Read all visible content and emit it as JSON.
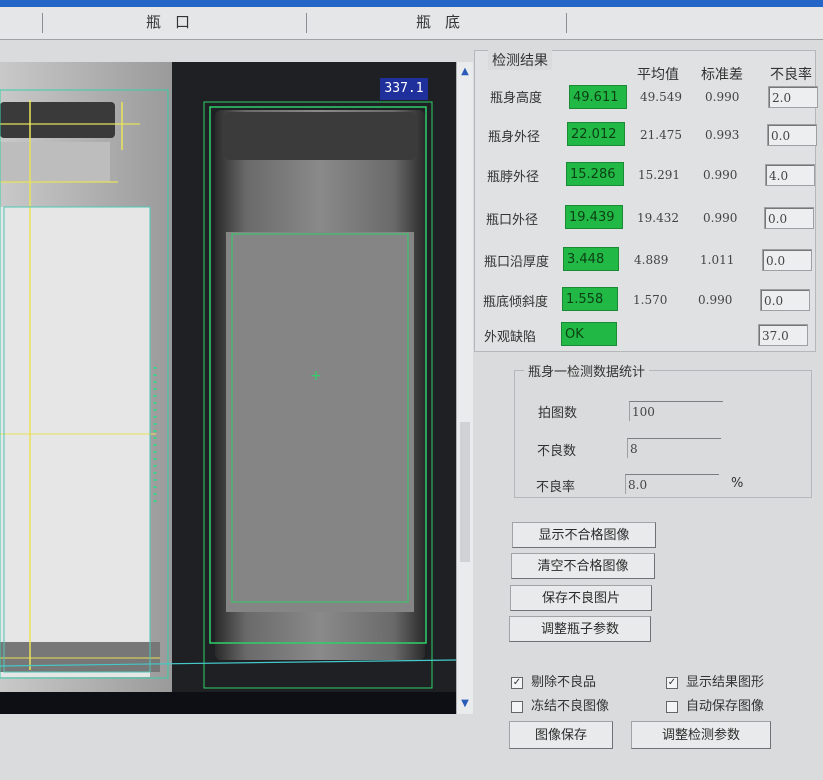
{
  "tabs": [
    {
      "label": "瓶口"
    },
    {
      "label": "瓶底"
    }
  ],
  "viewer": {
    "badge_value": "337.1"
  },
  "results": {
    "title": "检测结果",
    "columns": {
      "avg": "平均值",
      "std": "标准差",
      "rate": "不良率"
    },
    "rows": [
      {
        "label": "瓶身高度",
        "value": "49.611",
        "avg": "49.549",
        "std": "0.990",
        "rate": "2.0"
      },
      {
        "label": "瓶身外径",
        "value": "22.012",
        "avg": "21.475",
        "std": "0.993",
        "rate": "0.0"
      },
      {
        "label": "瓶脖外径",
        "value": "15.286",
        "avg": "15.291",
        "std": "0.990",
        "rate": "4.0"
      },
      {
        "label": "瓶口外径",
        "value": "19.439",
        "avg": "19.432",
        "std": "0.990",
        "rate": "0.0"
      },
      {
        "label": "瓶口沿厚度",
        "value": "3.448",
        "avg": "4.889",
        "std": "1.011",
        "rate": "0.0"
      },
      {
        "label": "瓶底倾斜度",
        "value": "1.558",
        "avg": "1.570",
        "std": "0.990",
        "rate": "0.0"
      },
      {
        "label": "外观缺陷",
        "value": "OK",
        "avg": "",
        "std": "",
        "rate": "37.0"
      }
    ]
  },
  "stats": {
    "title": "瓶身一检测数据统计",
    "shot_label": "拍图数",
    "shot_value": "100",
    "defect_label": "不良数",
    "defect_value": "8",
    "rate_label": "不良率",
    "rate_value": "8.0",
    "rate_unit": "%"
  },
  "buttons": {
    "show_ng": "显示不合格图像",
    "clear_ng": "清空不合格图像",
    "save_ng": "保存不良图片",
    "adjust_clamp": "调整瓶子参数",
    "save_image": "图像保存",
    "adjust_detect": "调整检测参数"
  },
  "options": [
    {
      "label": "剔除不良品",
      "checked": true
    },
    {
      "label": "显示结果图形",
      "checked": true
    },
    {
      "label": "冻结不良图像",
      "checked": false
    },
    {
      "label": "自动保存图像",
      "checked": false
    }
  ],
  "colors": {
    "ok_green": "#21b845",
    "roi_green": "#2fd06a",
    "guide_yellow": "#e8e25a",
    "badge_blue": "#1f2f9c"
  }
}
